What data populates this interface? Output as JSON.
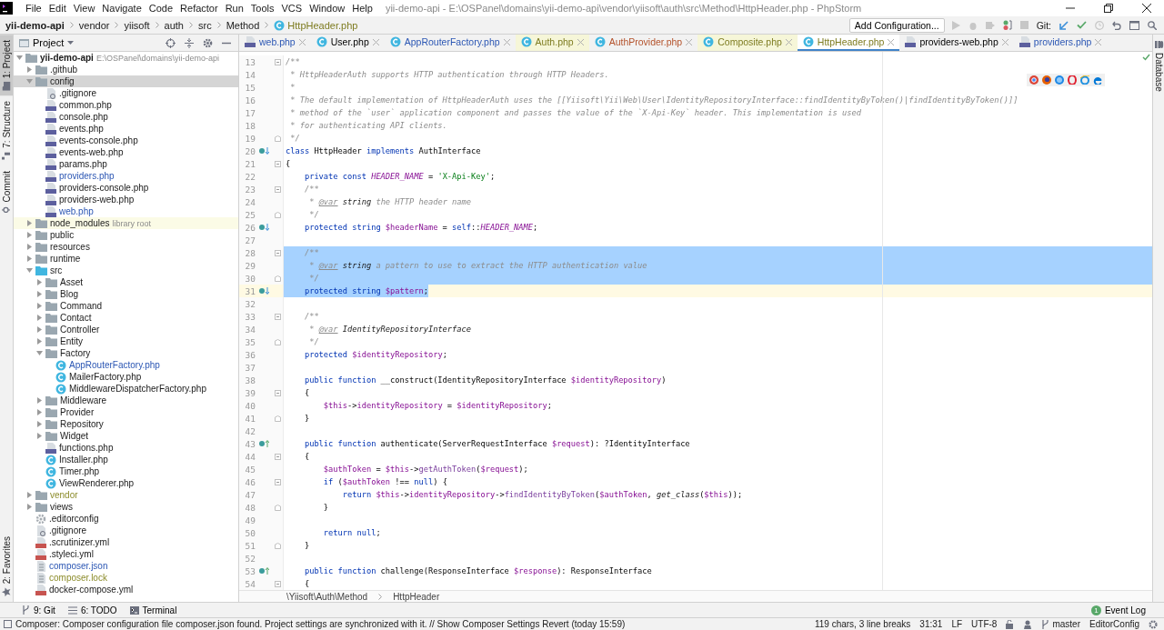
{
  "menu": [
    "File",
    "Edit",
    "View",
    "Navigate",
    "Code",
    "Refactor",
    "Run",
    "Tools",
    "VCS",
    "Window",
    "Help"
  ],
  "window": {
    "title": "yii-demo-api - E:\\OSPanel\\domains\\yii-demo-api\\vendor\\yiisoft\\auth\\src\\Method\\HttpHeader.php - PhpStorm"
  },
  "breadcrumbs": [
    {
      "label": "yii-demo-api",
      "kind": "project"
    },
    {
      "label": "vendor",
      "kind": "folder"
    },
    {
      "label": "yiisoft",
      "kind": "folder"
    },
    {
      "label": "auth",
      "kind": "folder"
    },
    {
      "label": "src",
      "kind": "folder"
    },
    {
      "label": "Method",
      "kind": "folder"
    },
    {
      "label": "HttpHeader.php",
      "kind": "class"
    }
  ],
  "toolbar": {
    "run_config": "Add Configuration...",
    "git_label": "Git:"
  },
  "tool_strip": {
    "left_top": [
      {
        "label": "1: Project",
        "kind": "folder",
        "selected": true
      },
      {
        "label": "7: Structure",
        "kind": "structure",
        "selected": false
      },
      {
        "label": "Commit",
        "kind": "commit",
        "selected": false
      }
    ],
    "left_bottom": [
      {
        "label": "2: Favorites",
        "kind": "star",
        "selected": false
      }
    ],
    "right": [
      {
        "label": "Database",
        "kind": "database",
        "selected": false
      }
    ]
  },
  "project": {
    "title": "Project",
    "tree": [
      {
        "label": "yii-demo-api",
        "kind": "project",
        "path": "E:\\OSPanel\\domains\\yii-demo-api",
        "modified": false,
        "ignored": false,
        "expanded": true,
        "selected": false,
        "children": [
          {
            "label": ".github",
            "kind": "folder",
            "modified": false,
            "ignored": false,
            "expanded": false,
            "selected": false
          },
          {
            "label": "config",
            "kind": "folder",
            "modified": false,
            "ignored": false,
            "expanded": true,
            "selected": true,
            "children": [
              {
                "label": ".gitignore",
                "kind": "ignore",
                "modified": false,
                "ignored": false,
                "selected": false
              },
              {
                "label": "common.php",
                "kind": "php",
                "modified": false,
                "ignored": false,
                "selected": false
              },
              {
                "label": "console.php",
                "kind": "php",
                "modified": false,
                "ignored": false,
                "selected": false
              },
              {
                "label": "events.php",
                "kind": "php",
                "modified": false,
                "ignored": false,
                "selected": false
              },
              {
                "label": "events-console.php",
                "kind": "php",
                "modified": false,
                "ignored": false,
                "selected": false
              },
              {
                "label": "events-web.php",
                "kind": "php",
                "modified": false,
                "ignored": false,
                "selected": false
              },
              {
                "label": "params.php",
                "kind": "php",
                "modified": false,
                "ignored": false,
                "selected": false
              },
              {
                "label": "providers.php",
                "kind": "php",
                "modified": true,
                "ignored": false,
                "selected": false
              },
              {
                "label": "providers-console.php",
                "kind": "php",
                "modified": false,
                "ignored": false,
                "selected": false
              },
              {
                "label": "providers-web.php",
                "kind": "php",
                "modified": false,
                "ignored": false,
                "selected": false
              },
              {
                "label": "web.php",
                "kind": "php",
                "modified": true,
                "ignored": false,
                "selected": false
              }
            ]
          },
          {
            "label": "node_modules",
            "kind": "folder",
            "hint": "library root",
            "library": true,
            "modified": false,
            "ignored": false,
            "expanded": false,
            "selected": false
          },
          {
            "label": "public",
            "kind": "folder",
            "modified": false,
            "ignored": false,
            "expanded": false,
            "selected": false
          },
          {
            "label": "resources",
            "kind": "folder",
            "modified": false,
            "ignored": false,
            "expanded": false,
            "selected": false
          },
          {
            "label": "runtime",
            "kind": "folder",
            "modified": false,
            "ignored": false,
            "expanded": false,
            "selected": false
          },
          {
            "label": "src",
            "kind": "source",
            "modified": false,
            "ignored": false,
            "expanded": true,
            "selected": false,
            "children": [
              {
                "label": "Asset",
                "kind": "folder",
                "modified": false,
                "ignored": false,
                "expanded": false,
                "selected": false
              },
              {
                "label": "Blog",
                "kind": "folder",
                "modified": false,
                "ignored": false,
                "expanded": false,
                "selected": false
              },
              {
                "label": "Command",
                "kind": "folder",
                "modified": false,
                "ignored": false,
                "expanded": false,
                "selected": false
              },
              {
                "label": "Contact",
                "kind": "folder",
                "modified": false,
                "ignored": false,
                "expanded": false,
                "selected": false
              },
              {
                "label": "Controller",
                "kind": "folder",
                "modified": false,
                "ignored": false,
                "expanded": false,
                "selected": false
              },
              {
                "label": "Entity",
                "kind": "folder",
                "modified": false,
                "ignored": false,
                "expanded": false,
                "selected": false
              },
              {
                "label": "Factory",
                "kind": "folder",
                "modified": false,
                "ignored": false,
                "expanded": true,
                "selected": false,
                "children": [
                  {
                    "label": "AppRouterFactory.php",
                    "kind": "class",
                    "modified": true,
                    "ignored": false,
                    "selected": false
                  },
                  {
                    "label": "MailerFactory.php",
                    "kind": "class",
                    "modified": false,
                    "ignored": false,
                    "selected": false
                  },
                  {
                    "label": "MiddlewareDispatcherFactory.php",
                    "kind": "class",
                    "modified": false,
                    "ignored": false,
                    "selected": false
                  }
                ]
              },
              {
                "label": "Middleware",
                "kind": "folder",
                "modified": false,
                "ignored": false,
                "expanded": false,
                "selected": false
              },
              {
                "label": "Provider",
                "kind": "folder",
                "modified": false,
                "ignored": false,
                "expanded": false,
                "selected": false
              },
              {
                "label": "Repository",
                "kind": "folder",
                "modified": false,
                "ignored": false,
                "expanded": false,
                "selected": false
              },
              {
                "label": "Widget",
                "kind": "folder",
                "modified": false,
                "ignored": false,
                "expanded": false,
                "selected": false
              },
              {
                "label": "functions.php",
                "kind": "php",
                "modified": false,
                "ignored": false,
                "selected": false
              },
              {
                "label": "Installer.php",
                "kind": "class",
                "modified": false,
                "ignored": false,
                "selected": false
              },
              {
                "label": "Timer.php",
                "kind": "class",
                "modified": false,
                "ignored": false,
                "selected": false
              },
              {
                "label": "ViewRenderer.php",
                "kind": "class",
                "modified": false,
                "ignored": false,
                "selected": false
              }
            ]
          },
          {
            "label": "vendor",
            "kind": "folder",
            "modified": false,
            "ignored": true,
            "expanded": false,
            "selected": false
          },
          {
            "label": "views",
            "kind": "folder",
            "modified": false,
            "ignored": false,
            "expanded": false,
            "selected": false
          },
          {
            "label": ".editorconfig",
            "kind": "settings",
            "modified": false,
            "ignored": false,
            "selected": false
          },
          {
            "label": ".gitignore",
            "kind": "ignore",
            "modified": false,
            "ignored": false,
            "selected": false
          },
          {
            "label": ".scrutinizer.yml",
            "kind": "yml",
            "modified": false,
            "ignored": false,
            "selected": false
          },
          {
            "label": ".styleci.yml",
            "kind": "yml",
            "modified": false,
            "ignored": false,
            "selected": false
          },
          {
            "label": "composer.json",
            "kind": "json",
            "modified": true,
            "ignored": false,
            "selected": false
          },
          {
            "label": "composer.lock",
            "kind": "json",
            "modified": false,
            "ignored": true,
            "selected": false
          },
          {
            "label": "docker-compose.yml",
            "kind": "yml",
            "modified": false,
            "ignored": false,
            "selected": false
          }
        ]
      }
    ]
  },
  "tabs": [
    {
      "label": "web.php",
      "kind": "php",
      "modified": true,
      "unversioned": false,
      "library": false,
      "selected": false
    },
    {
      "label": "User.php",
      "kind": "class",
      "modified": false,
      "unversioned": false,
      "library": false,
      "selected": false
    },
    {
      "label": "AppRouterFactory.php",
      "kind": "class",
      "modified": true,
      "unversioned": false,
      "library": false,
      "selected": false
    },
    {
      "label": "Auth.php",
      "kind": "class",
      "modified": false,
      "unversioned": false,
      "library": true,
      "selected": false
    },
    {
      "label": "AuthProvider.php",
      "kind": "class",
      "modified": false,
      "unversioned": true,
      "library": false,
      "selected": false
    },
    {
      "label": "Composite.php",
      "kind": "class",
      "modified": false,
      "unversioned": false,
      "library": true,
      "selected": false
    },
    {
      "label": "HttpHeader.php",
      "kind": "class",
      "modified": false,
      "unversioned": false,
      "library": true,
      "selected": true
    },
    {
      "label": "providers-web.php",
      "kind": "php",
      "modified": false,
      "unversioned": false,
      "library": false,
      "selected": false
    },
    {
      "label": "providers.php",
      "kind": "php",
      "modified": true,
      "unversioned": false,
      "library": false,
      "selected": false
    }
  ],
  "editor": {
    "lines": [
      {
        "number": "13",
        "fold_start": true,
        "tokens": [
          {
            "kind": "comment",
            "text": "/**"
          }
        ]
      },
      {
        "number": "14",
        "tokens": [
          {
            "kind": "comment",
            "text": " * HttpHeaderAuth supports HTTP authentication through HTTP Headers."
          }
        ]
      },
      {
        "number": "15",
        "tokens": [
          {
            "kind": "comment",
            "text": " *"
          }
        ]
      },
      {
        "number": "16",
        "tokens": [
          {
            "kind": "comment",
            "text": " * The default implementation of HttpHeaderAuth uses the [[Yiisoft\\Yii\\Web\\User\\IdentityRepositoryInterface::findIdentityByToken()|findIdentityByToken()]]"
          }
        ]
      },
      {
        "number": "17",
        "tokens": [
          {
            "kind": "comment",
            "text": " * method of the `user` application component and passes the value of the `X-Api-Key` header. This implementation is used"
          }
        ]
      },
      {
        "number": "18",
        "tokens": [
          {
            "kind": "comment",
            "text": " * for authenticating API clients."
          }
        ]
      },
      {
        "number": "19",
        "fold_end": true,
        "tokens": [
          {
            "kind": "comment",
            "text": " */"
          }
        ]
      },
      {
        "number": "20",
        "implements": true,
        "tokens": [
          {
            "kind": "keyword",
            "text": "class "
          },
          {
            "kind": "plain",
            "text": "HttpHeader "
          },
          {
            "kind": "keyword",
            "text": "implements "
          },
          {
            "kind": "plain",
            "text": "AuthInterface"
          }
        ]
      },
      {
        "number": "21",
        "fold_start": true,
        "tokens": [
          {
            "kind": "plain",
            "text": "{"
          }
        ]
      },
      {
        "number": "22",
        "tokens": [
          {
            "kind": "keyword",
            "text": "    private const "
          },
          {
            "kind": "constant",
            "text": "HEADER_NAME"
          },
          {
            "kind": "plain",
            "text": " = "
          },
          {
            "kind": "string",
            "text": "'X-Api-Key'"
          },
          {
            "kind": "plain",
            "text": ";"
          }
        ]
      },
      {
        "number": "23",
        "fold_start": true,
        "tokens": [
          {
            "kind": "comment",
            "text": "    /**"
          }
        ]
      },
      {
        "number": "24",
        "tokens": [
          {
            "kind": "comment",
            "text": "     * "
          },
          {
            "kind": "doctag",
            "text": "@var"
          },
          {
            "kind": "doctype",
            "text": " string"
          },
          {
            "kind": "comment",
            "text": " the HTTP header name"
          }
        ]
      },
      {
        "number": "25",
        "fold_end": true,
        "tokens": [
          {
            "kind": "comment",
            "text": "     */"
          }
        ]
      },
      {
        "number": "26",
        "implements": true,
        "tokens": [
          {
            "kind": "keyword",
            "text": "    protected string "
          },
          {
            "kind": "variable",
            "text": "$headerName"
          },
          {
            "kind": "plain",
            "text": " = "
          },
          {
            "kind": "keyword",
            "text": "self"
          },
          {
            "kind": "plain",
            "text": "::"
          },
          {
            "kind": "constant",
            "text": "HEADER_NAME"
          },
          {
            "kind": "plain",
            "text": ";"
          }
        ]
      },
      {
        "number": "27"
      },
      {
        "number": "28",
        "fold_start": true,
        "selected": true,
        "tokens": [
          {
            "kind": "comment",
            "text": "    /**"
          }
        ]
      },
      {
        "number": "29",
        "selected": true,
        "tokens": [
          {
            "kind": "comment",
            "text": "     * "
          },
          {
            "kind": "doctag",
            "text": "@var"
          },
          {
            "kind": "doctype",
            "text": " string"
          },
          {
            "kind": "comment",
            "text": " a pattern to use to extract the HTTP authentication value"
          }
        ]
      },
      {
        "number": "30",
        "fold_end": true,
        "selected": true,
        "tokens": [
          {
            "kind": "comment",
            "text": "     */"
          }
        ]
      },
      {
        "number": "31",
        "implements": true,
        "selected": true,
        "current": true,
        "tokens": [
          {
            "kind": "keyword",
            "text": "    protected string "
          },
          {
            "kind": "variable",
            "text": "$pattern"
          },
          {
            "kind": "plain",
            "text": ";"
          }
        ]
      },
      {
        "number": "32"
      },
      {
        "number": "33",
        "fold_start": true,
        "tokens": [
          {
            "kind": "comment",
            "text": "    /**"
          }
        ]
      },
      {
        "number": "34",
        "tokens": [
          {
            "kind": "comment",
            "text": "     * "
          },
          {
            "kind": "doctag",
            "text": "@var"
          },
          {
            "kind": "doctype",
            "text": " IdentityRepositoryInterface"
          }
        ]
      },
      {
        "number": "35",
        "fold_end": true,
        "tokens": [
          {
            "kind": "comment",
            "text": "     */"
          }
        ]
      },
      {
        "number": "36",
        "tokens": [
          {
            "kind": "keyword",
            "text": "    protected "
          },
          {
            "kind": "variable",
            "text": "$identityRepository"
          },
          {
            "kind": "plain",
            "text": ";"
          }
        ]
      },
      {
        "number": "37"
      },
      {
        "number": "38",
        "tokens": [
          {
            "kind": "keyword",
            "text": "    public function "
          },
          {
            "kind": "plain",
            "text": "__construct(IdentityRepositoryInterface "
          },
          {
            "kind": "variable",
            "text": "$identityRepository"
          },
          {
            "kind": "plain",
            "text": ")"
          }
        ]
      },
      {
        "number": "39",
        "fold_start": true,
        "tokens": [
          {
            "kind": "plain",
            "text": "    {"
          }
        ]
      },
      {
        "number": "40",
        "tokens": [
          {
            "kind": "variable",
            "text": "        $this"
          },
          {
            "kind": "plain",
            "text": "->"
          },
          {
            "kind": "variable",
            "text": "identityRepository"
          },
          {
            "kind": "plain",
            "text": " = "
          },
          {
            "kind": "variable",
            "text": "$identityRepository"
          },
          {
            "kind": "plain",
            "text": ";"
          }
        ]
      },
      {
        "number": "41",
        "fold_end": true,
        "tokens": [
          {
            "kind": "plain",
            "text": "    }"
          }
        ]
      },
      {
        "number": "42"
      },
      {
        "number": "43",
        "overrides": true,
        "tokens": [
          {
            "kind": "keyword",
            "text": "    public function "
          },
          {
            "kind": "plain",
            "text": "authenticate(ServerRequestInterface "
          },
          {
            "kind": "variable",
            "text": "$request"
          },
          {
            "kind": "plain",
            "text": "): ?IdentityInterface"
          }
        ]
      },
      {
        "number": "44",
        "fold_start": true,
        "tokens": [
          {
            "kind": "plain",
            "text": "    {"
          }
        ]
      },
      {
        "number": "45",
        "tokens": [
          {
            "kind": "variable",
            "text": "        $authToken"
          },
          {
            "kind": "plain",
            "text": " = "
          },
          {
            "kind": "variable",
            "text": "$this"
          },
          {
            "kind": "plain",
            "text": "->"
          },
          {
            "kind": "method",
            "text": "getAuthToken"
          },
          {
            "kind": "plain",
            "text": "("
          },
          {
            "kind": "variable",
            "text": "$request"
          },
          {
            "kind": "plain",
            "text": ");"
          }
        ]
      },
      {
        "number": "46",
        "fold_start": true,
        "tokens": [
          {
            "kind": "keyword",
            "text": "        if "
          },
          {
            "kind": "plain",
            "text": "("
          },
          {
            "kind": "variable",
            "text": "$authToken"
          },
          {
            "kind": "plain",
            "text": " !== "
          },
          {
            "kind": "keyword",
            "text": "null"
          },
          {
            "kind": "plain",
            "text": ") {"
          }
        ]
      },
      {
        "number": "47",
        "tokens": [
          {
            "kind": "keyword",
            "text": "            return "
          },
          {
            "kind": "variable",
            "text": "$this"
          },
          {
            "kind": "plain",
            "text": "->"
          },
          {
            "kind": "variable",
            "text": "identityRepository"
          },
          {
            "kind": "plain",
            "text": "->"
          },
          {
            "kind": "method",
            "text": "findIdentityByToken"
          },
          {
            "kind": "plain",
            "text": "("
          },
          {
            "kind": "variable",
            "text": "$authToken"
          },
          {
            "kind": "plain",
            "text": ", "
          },
          {
            "kind": "function",
            "text": "get_class"
          },
          {
            "kind": "plain",
            "text": "("
          },
          {
            "kind": "variable",
            "text": "$this"
          },
          {
            "kind": "plain",
            "text": "));"
          }
        ]
      },
      {
        "number": "48",
        "fold_end": true,
        "tokens": [
          {
            "kind": "plain",
            "text": "        }"
          }
        ]
      },
      {
        "number": "49"
      },
      {
        "number": "50",
        "tokens": [
          {
            "kind": "keyword",
            "text": "        return null"
          },
          {
            "kind": "plain",
            "text": ";"
          }
        ]
      },
      {
        "number": "51",
        "fold_end": true,
        "tokens": [
          {
            "kind": "plain",
            "text": "    }"
          }
        ]
      },
      {
        "number": "52"
      },
      {
        "number": "53",
        "overrides": true,
        "tokens": [
          {
            "kind": "keyword",
            "text": "    public function "
          },
          {
            "kind": "plain",
            "text": "challenge(ResponseInterface "
          },
          {
            "kind": "variable",
            "text": "$response"
          },
          {
            "kind": "plain",
            "text": "): ResponseInterface"
          }
        ]
      },
      {
        "number": "54",
        "fold_start": true,
        "tokens": [
          {
            "kind": "plain",
            "text": "    {"
          }
        ]
      }
    ],
    "breadcrumbs": [
      "\\Yiisoft\\Auth\\Method",
      "HttpHeader"
    ]
  },
  "bottom_tabs": [
    {
      "label": "9: Git",
      "kind": "branch"
    },
    {
      "label": "6: TODO",
      "kind": "list"
    },
    {
      "label": "Terminal",
      "kind": "terminal"
    }
  ],
  "event_log": {
    "label": "Event Log",
    "count": "1"
  },
  "status_bar": {
    "message": "Composer: Composer configuration file composer.json found. Project settings are synchronized with it. // Show Composer Settings  Revert (today 15:59)",
    "selection": "119 chars, 3 line breaks",
    "position": "31:31",
    "line_ending": "LF",
    "encoding": "UTF-8",
    "branch": "master",
    "code_style": "EditorConfig"
  }
}
